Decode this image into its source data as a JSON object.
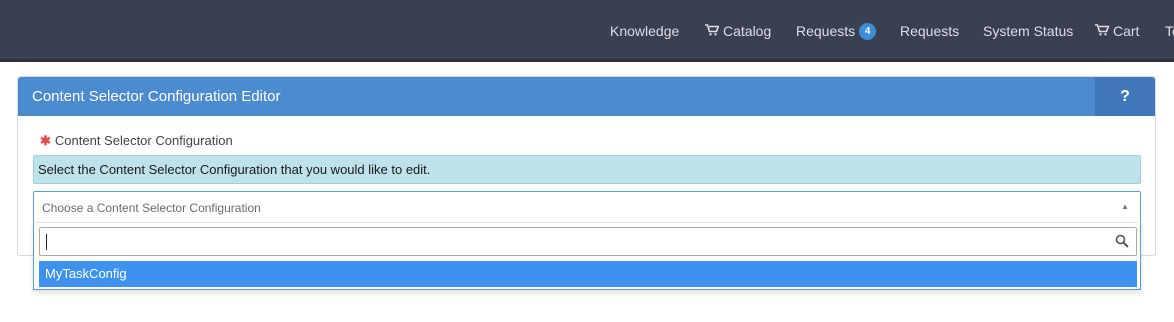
{
  "nav": {
    "knowledge": "Knowledge",
    "catalog": "Catalog",
    "requests_badge": "Requests",
    "requests_badge_count": "4",
    "requests": "Requests",
    "system_status": "System Status",
    "cart": "Cart",
    "overflow": "To"
  },
  "panel": {
    "title": "Content Selector Configuration Editor",
    "help_label": "?"
  },
  "form": {
    "required_mark": "✱",
    "field_label": "Content Selector Configuration",
    "hint": "Select the Content Selector Configuration that you would like to edit.",
    "select_placeholder": "Choose a Content Selector Configuration",
    "search_value": "",
    "options": [
      "MyTaskConfig"
    ]
  },
  "colors": {
    "topbar": "#3a3f51",
    "panel_header": "#4c8bd0",
    "hint_bg": "#bde2ea",
    "highlight": "#3d92f0",
    "badge": "#3c8edb"
  }
}
